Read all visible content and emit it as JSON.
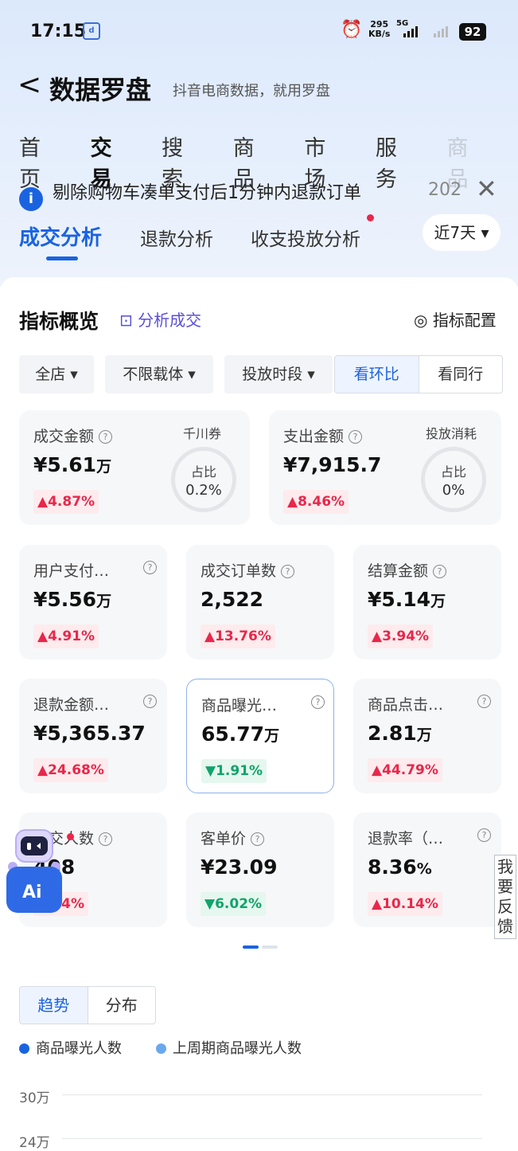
{
  "status_bar": {
    "time": "17:15",
    "speed_top": "295",
    "speed_bottom": "KB/s",
    "network": "5G",
    "battery": "92"
  },
  "header": {
    "back_glyph": "<",
    "title": "数据罗盘",
    "subtitle": "抖音电商数据，就用罗盘"
  },
  "nav_tabs": [
    {
      "label": "首页"
    },
    {
      "label": "交易"
    },
    {
      "label": "搜索"
    },
    {
      "label": "商品"
    },
    {
      "label": "市场"
    },
    {
      "label": "服务"
    },
    {
      "label": "商品"
    }
  ],
  "notice": {
    "text": "剔除购物车凑单支付后1分钟内退款订单",
    "year": "202",
    "close_glyph": "✕"
  },
  "sub_tabs": {
    "items": [
      "成交分析",
      "退款分析",
      "收支投放分析"
    ],
    "period": "近7天 ▾"
  },
  "overview": {
    "title": "指标概览",
    "ai_link": "分析成交",
    "config": "指标配置"
  },
  "filters": {
    "store": "全店 ▾",
    "carrier": "不限载体 ▾",
    "time": "投放时段 ▾",
    "compare_on": "看环比",
    "compare_off": "看同行"
  },
  "cards": {
    "gmv": {
      "label": "成交金额",
      "value": "¥5.61",
      "unit": "万",
      "delta": "▲4.87%",
      "ring_title": "千川券",
      "ring_label": "占比",
      "ring_value": "0.2%"
    },
    "spend": {
      "label": "支出金额",
      "value": "¥7,915.7",
      "unit": "",
      "delta": "▲8.46%",
      "ring_title": "投放消耗",
      "ring_label": "占比",
      "ring_value": "0%"
    },
    "user_pay": {
      "label": "用户支付…",
      "value": "¥5.56",
      "unit": "万",
      "delta": "▲4.91%"
    },
    "orders": {
      "label": "成交订单数",
      "value": "2,522",
      "unit": "",
      "delta": "▲13.76%"
    },
    "settle": {
      "label": "结算金额",
      "value": "¥5.14",
      "unit": "万",
      "delta": "▲3.94%"
    },
    "refund_amt": {
      "label": "退款金额…",
      "value": "¥5,365.37",
      "unit": "",
      "delta": "▲24.68%"
    },
    "exposure": {
      "label": "商品曝光…",
      "value": "65.77",
      "unit": "万",
      "delta": "▼1.91%"
    },
    "clicks": {
      "label": "商品点击…",
      "value": "2.81",
      "unit": "万",
      "delta": "▲44.79%"
    },
    "buyers": {
      "label": "成交人数",
      "value": "408",
      "unit": "",
      "delta": "1.64%"
    },
    "aov": {
      "label": "客单价",
      "value": "¥23.09",
      "unit": "",
      "delta": "▼6.02%"
    },
    "refund_rate": {
      "label": "退款率（…",
      "value": "8.36",
      "unit": "%",
      "delta": "▲10.14%"
    }
  },
  "feedback": "我要反馈",
  "trend": {
    "tab_on": "趋势",
    "tab_off": "分布",
    "legend": [
      {
        "name": "商品曝光人数",
        "color": "#1a63e0"
      },
      {
        "name": "上周期商品曝光人数",
        "color": "#6aa8ee"
      }
    ],
    "y_ticks": [
      "30万",
      "24万"
    ]
  },
  "colors": {
    "accent": "#1a63e0",
    "up": "#e8274b",
    "down": "#11a36b"
  },
  "icons": {
    "back": "chevron-left-icon",
    "info": "info-icon",
    "close": "close-icon",
    "ai": "ai-robot-icon",
    "config": "settings-icon"
  }
}
